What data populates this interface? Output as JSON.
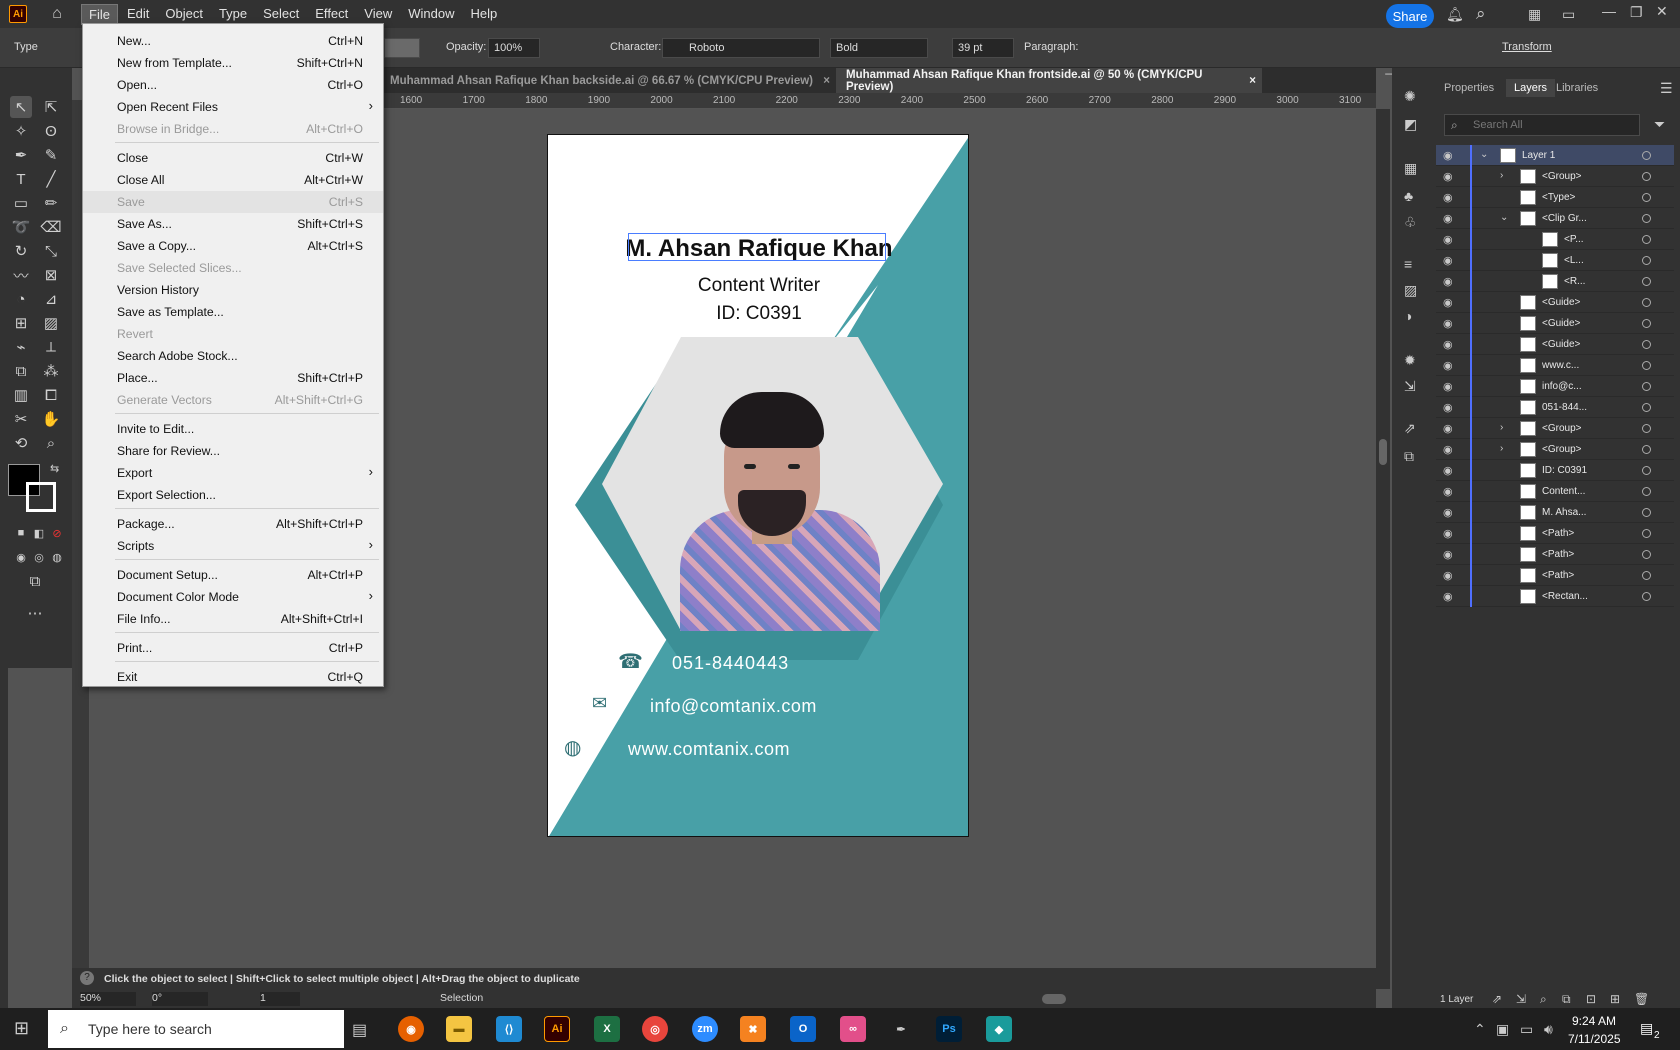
{
  "app": {
    "logo": "Ai",
    "share_label": "Share"
  },
  "menubar": {
    "items": [
      "File",
      "Edit",
      "Object",
      "Type",
      "Select",
      "Effect",
      "View",
      "Window",
      "Help"
    ]
  },
  "controlbar": {
    "type_label": "Type",
    "opacity_label": "Opacity:",
    "opacity_value": "100%",
    "character_label": "Character:",
    "font_value": "Roboto",
    "style_value": "Bold",
    "size_value": "39 pt",
    "paragraph_label": "Paragraph:",
    "transform_label": "Transform"
  },
  "tabs": [
    {
      "label": "Muhammad Ahsan Rafique Khan backside.ai @ 66.67 % (CMYK/CPU Preview)",
      "close": "×"
    },
    {
      "label": "Muhammad Ahsan Rafique Khan frontside.ai @ 50 % (CMYK/CPU Preview)",
      "close": "×"
    }
  ],
  "ruler": [
    "1600",
    "1700",
    "1800",
    "1900",
    "2000",
    "2100",
    "2200",
    "2300",
    "2400",
    "2500",
    "2600",
    "2700",
    "2800",
    "2900",
    "3000",
    "3100"
  ],
  "card": {
    "name": "M. Ahsan Rafique Khan",
    "role": "Content Writer",
    "id": "ID: C0391",
    "phone": "051-8440443",
    "email": "info@comtanix.com",
    "web": "www.comtanix.com",
    "accent": "#48a0a7",
    "accent_dark": "#3b8f96"
  },
  "file_menu": [
    {
      "label": "New...",
      "shortcut": "Ctrl+N"
    },
    {
      "label": "New from Template...",
      "shortcut": "Shift+Ctrl+N"
    },
    {
      "label": "Open...",
      "shortcut": "Ctrl+O"
    },
    {
      "label": "Open Recent Files",
      "shortcut": "",
      "submenu": true
    },
    {
      "label": "Browse in Bridge...",
      "shortcut": "Alt+Ctrl+O",
      "disabled": true,
      "sep_after": true
    },
    {
      "label": "Close",
      "shortcut": "Ctrl+W"
    },
    {
      "label": "Close All",
      "shortcut": "Alt+Ctrl+W"
    },
    {
      "label": "Save",
      "shortcut": "Ctrl+S",
      "disabled": true,
      "hover": true
    },
    {
      "label": "Save As...",
      "shortcut": "Shift+Ctrl+S"
    },
    {
      "label": "Save a Copy...",
      "shortcut": "Alt+Ctrl+S"
    },
    {
      "label": "Save Selected Slices...",
      "shortcut": "",
      "disabled": true
    },
    {
      "label": "Version History",
      "shortcut": ""
    },
    {
      "label": "Save as Template...",
      "shortcut": ""
    },
    {
      "label": "Revert",
      "shortcut": "",
      "disabled": true
    },
    {
      "label": "Search Adobe Stock...",
      "shortcut": ""
    },
    {
      "label": "Place...",
      "shortcut": "Shift+Ctrl+P"
    },
    {
      "label": "Generate Vectors",
      "shortcut": "Alt+Shift+Ctrl+G",
      "disabled": true,
      "sep_after": true
    },
    {
      "label": "Invite to Edit...",
      "shortcut": ""
    },
    {
      "label": "Share for Review...",
      "shortcut": ""
    },
    {
      "label": "Export",
      "shortcut": "",
      "submenu": true
    },
    {
      "label": "Export Selection...",
      "shortcut": "",
      "sep_after": true
    },
    {
      "label": "Package...",
      "shortcut": "Alt+Shift+Ctrl+P"
    },
    {
      "label": "Scripts",
      "shortcut": "",
      "submenu": true,
      "sep_after": true
    },
    {
      "label": "Document Setup...",
      "shortcut": "Alt+Ctrl+P"
    },
    {
      "label": "Document Color Mode",
      "shortcut": "",
      "submenu": true
    },
    {
      "label": "File Info...",
      "shortcut": "Alt+Shift+Ctrl+I",
      "sep_after": true
    },
    {
      "label": "Print...",
      "shortcut": "Ctrl+P",
      "sep_after": true
    },
    {
      "label": "Exit",
      "shortcut": "Ctrl+Q"
    }
  ],
  "panel": {
    "tabs": [
      "Properties",
      "Layers",
      "Libraries"
    ],
    "search_placeholder": "Search All",
    "footer": "1 Layer",
    "layers": [
      {
        "name": "Layer 1",
        "indent": 0,
        "chev": "⌄"
      },
      {
        "name": "<Group>",
        "indent": 1,
        "chev": "›"
      },
      {
        "name": "<Type>",
        "indent": 1
      },
      {
        "name": "<Clip Gr...",
        "indent": 1,
        "chev": "⌄"
      },
      {
        "name": "<P...",
        "indent": 2
      },
      {
        "name": "<L...",
        "indent": 2
      },
      {
        "name": "<R...",
        "indent": 2
      },
      {
        "name": "<Guide>",
        "indent": 1
      },
      {
        "name": "<Guide>",
        "indent": 1
      },
      {
        "name": "<Guide>",
        "indent": 1
      },
      {
        "name": "www.c...",
        "indent": 1
      },
      {
        "name": "info@c...",
        "indent": 1
      },
      {
        "name": "051-844...",
        "indent": 1
      },
      {
        "name": "<Group>",
        "indent": 1,
        "chev": "›"
      },
      {
        "name": "<Group>",
        "indent": 1,
        "chev": "›"
      },
      {
        "name": "ID: C0391",
        "indent": 1
      },
      {
        "name": "Content...",
        "indent": 1
      },
      {
        "name": "M. Ahsa...",
        "indent": 1
      },
      {
        "name": "<Path>",
        "indent": 1
      },
      {
        "name": "<Path>",
        "indent": 1
      },
      {
        "name": "<Path>",
        "indent": 1
      },
      {
        "name": "<Rectan...",
        "indent": 1
      }
    ]
  },
  "status": {
    "hint": "Click the object to select  |  Shift+Click to select multiple object  |  Alt+Drag the object to duplicate",
    "zoom": "50%",
    "rotate": "0°",
    "artboard": "1",
    "tool": "Selection"
  },
  "taskbar": {
    "search_placeholder": "Type here to search",
    "time": "9:24 AM",
    "date": "7/11/2025",
    "notif": "2"
  }
}
